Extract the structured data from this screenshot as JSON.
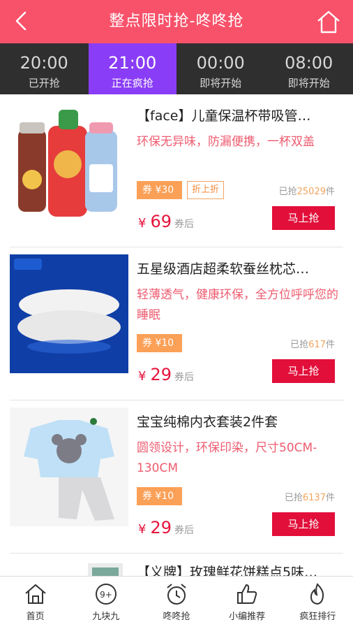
{
  "header": {
    "title": "整点限时抢-咚咚抢",
    "back_icon": "chevron-left-icon",
    "home_icon": "home-icon"
  },
  "tabs": [
    {
      "time": "20:00",
      "status": "已开抢"
    },
    {
      "time": "21:00",
      "status": "正在疯抢",
      "active": true
    },
    {
      "time": "00:00",
      "status": "即将开始"
    },
    {
      "time": "08:00",
      "status": "即将开始"
    }
  ],
  "products": [
    {
      "name": "【face】儿童保温杯带吸管…",
      "desc": "环保无异味，防漏便携，一杯双盖",
      "coupon": "券 ¥30",
      "tag": "折上折",
      "sold_prefix": "已抢",
      "sold_count": "25029",
      "sold_suffix": "件",
      "currency": "¥",
      "price": "69",
      "price_suffix": "券后",
      "buy": "马上抢"
    },
    {
      "name": "五星级酒店超柔软蚕丝枕芯…",
      "desc": "轻薄透气，健康环保，全方位呼呼您的睡眠",
      "coupon": "券 ¥10",
      "sold_prefix": "已抢",
      "sold_count": "617",
      "sold_suffix": "件",
      "currency": "¥",
      "price": "29",
      "price_suffix": "券后",
      "buy": "马上抢"
    },
    {
      "name": "宝宝纯棉内衣套装2件套",
      "desc": "圆领设计，环保印染，尺寸50CM-130CM",
      "coupon": "券 ¥10",
      "sold_prefix": "已抢",
      "sold_count": "6137",
      "sold_suffix": "件",
      "currency": "¥",
      "price": "29",
      "price_suffix": "券后",
      "buy": "马上抢"
    },
    {
      "name": "【义牌】玫瑰鲜花饼糕点5味…"
    }
  ],
  "bottom_nav": [
    {
      "label": "首页",
      "icon": "home-icon"
    },
    {
      "label": "九块九",
      "icon": "nine-plus-icon"
    },
    {
      "label": "咚咚抢",
      "icon": "alarm-clock-icon"
    },
    {
      "label": "小编推荐",
      "icon": "thumbs-up-icon"
    },
    {
      "label": "疯狂排行",
      "icon": "flame-icon"
    }
  ]
}
